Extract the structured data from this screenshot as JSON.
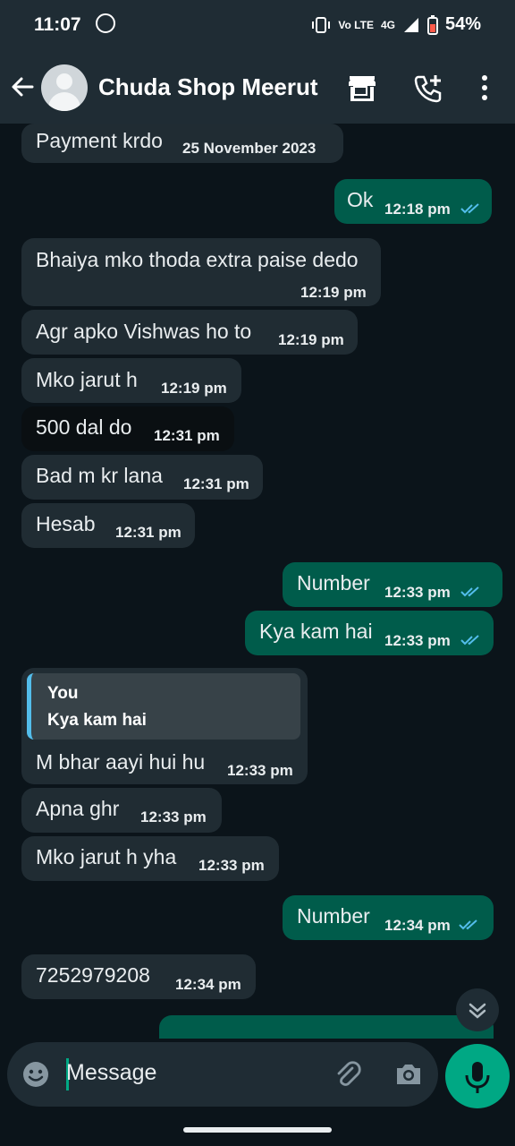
{
  "status_bar": {
    "time": "11:07",
    "network": "4G",
    "battery": "54%",
    "volte": "Vo LTE"
  },
  "header": {
    "contact_name": "Chuda Shop Meerut"
  },
  "messages": [
    {
      "text": "Payment krdo",
      "time": "25 November 2023",
      "direction": "in"
    },
    {
      "text": "Ok",
      "time": "12:18 pm",
      "direction": "out",
      "read": true
    },
    {
      "text": "Bhaiya mko thoda extra paise dedo",
      "time": "12:19 pm",
      "direction": "in"
    },
    {
      "text": "Agr apko Vishwas ho to",
      "time": "12:19 pm",
      "direction": "in"
    },
    {
      "text": "Mko jarut h",
      "time": "12:19 pm",
      "direction": "in"
    },
    {
      "text": "500 dal do",
      "time": "12:31 pm",
      "direction": "in",
      "highlighted": true
    },
    {
      "text": "Bad m kr lana",
      "time": "12:31 pm",
      "direction": "in"
    },
    {
      "text": "Hesab",
      "time": "12:31 pm",
      "direction": "in"
    },
    {
      "text": "Number",
      "time": "12:33 pm",
      "direction": "out",
      "read": true
    },
    {
      "text": "Kya kam hai",
      "time": "12:33 pm",
      "direction": "out",
      "read": true
    },
    {
      "text": "M bhar aayi hui hu",
      "time": "12:33 pm",
      "direction": "in",
      "quote_author": "You",
      "quote_text": "Kya kam hai"
    },
    {
      "text": "Apna ghr",
      "time": "12:33 pm",
      "direction": "in"
    },
    {
      "text": "Mko jarut h yha",
      "time": "12:33 pm",
      "direction": "in"
    },
    {
      "text": "Number",
      "time": "12:34 pm",
      "direction": "out",
      "read": true
    },
    {
      "text": "7252979208",
      "time": "12:34 pm",
      "direction": "in"
    }
  ],
  "input": {
    "placeholder": "Message"
  },
  "icons": {
    "back": "back-arrow-icon",
    "shop": "shop-icon",
    "add_call": "add-call-icon",
    "menu": "menu-icon",
    "emoji": "emoji-icon",
    "attach": "attach-icon",
    "camera": "camera-icon",
    "mic": "mic-icon",
    "scroll_down": "chevron-down-icon"
  },
  "colors": {
    "incoming": "#202c33",
    "outgoing": "#005c4b",
    "accent": "#00a884",
    "read_ticks": "#53bdeb"
  }
}
